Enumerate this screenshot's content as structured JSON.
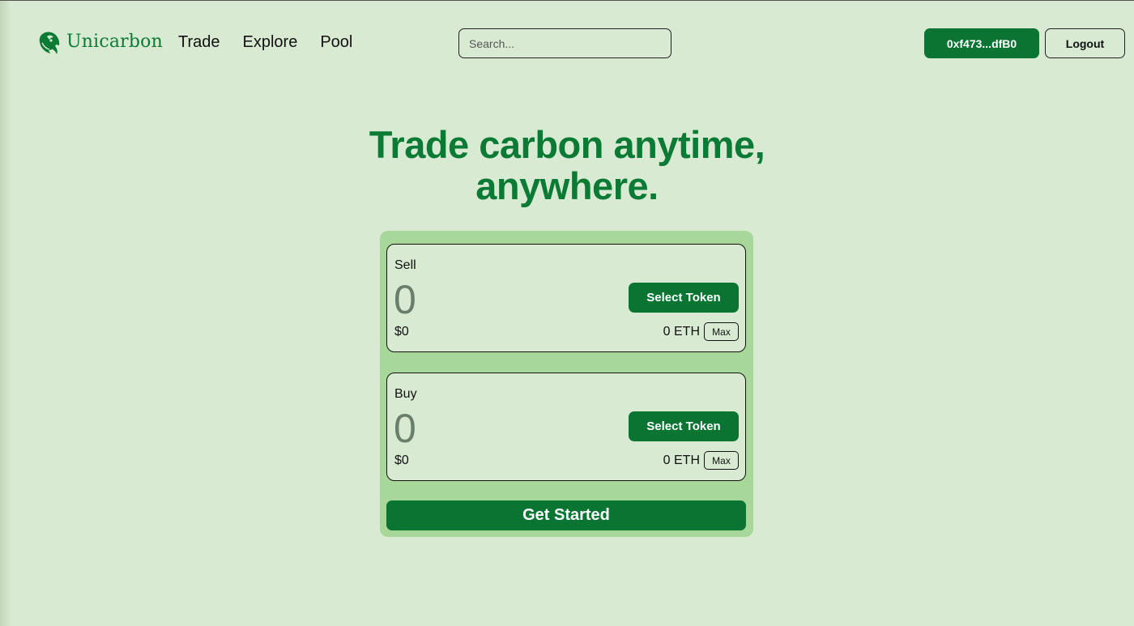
{
  "brand": {
    "name": "Unicarbon",
    "logo_icon": "unicorn-icon",
    "accent_color": "#0a7433"
  },
  "nav": {
    "items": [
      {
        "label": "Trade"
      },
      {
        "label": "Explore"
      },
      {
        "label": "Pool"
      }
    ]
  },
  "search": {
    "placeholder": "Search..."
  },
  "account": {
    "wallet_label": "0xf473...dfB0",
    "logout_label": "Logout"
  },
  "hero": {
    "line1": "Trade carbon anytime,",
    "line2": "anywhere."
  },
  "swap": {
    "sell": {
      "label": "Sell",
      "amount": "0",
      "token_button": "Select Token",
      "usd_value": "$0",
      "balance": "0 ETH",
      "max_label": "Max"
    },
    "buy": {
      "label": "Buy",
      "amount": "0",
      "token_button": "Select Token",
      "usd_value": "$0",
      "balance": "0 ETH",
      "max_label": "Max"
    },
    "cta_label": "Get Started"
  }
}
